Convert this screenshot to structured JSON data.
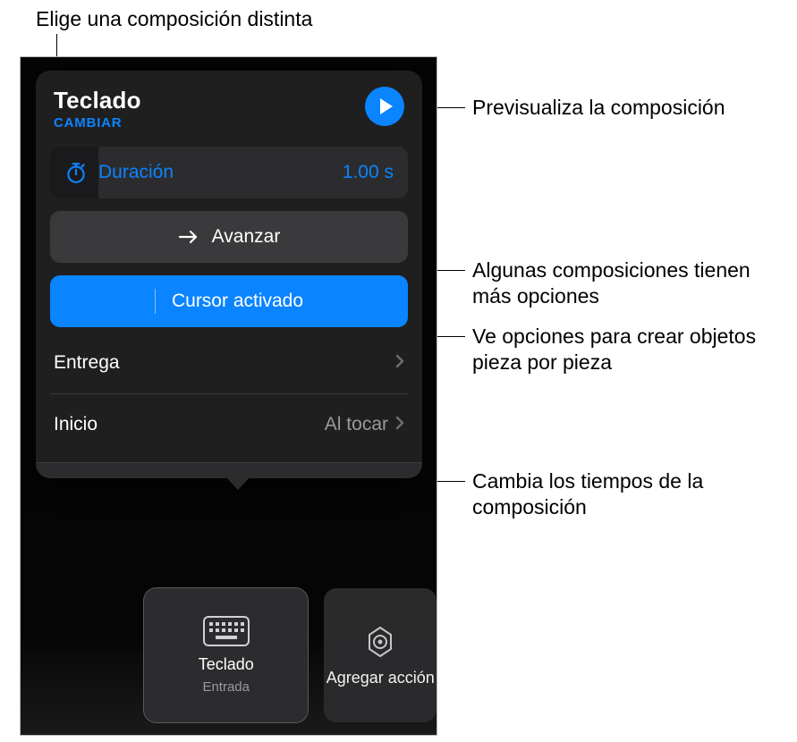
{
  "callouts": {
    "top": "Elige una composición distinta",
    "right1": "Previsualiza la composición",
    "right2": "Algunas composiciones tienen más opciones",
    "right3": "Ve opciones para crear objetos pieza por pieza",
    "right4": "Cambia los tiempos de la composición"
  },
  "popover": {
    "title": "Teclado",
    "change": "CAMBIAR",
    "duration_label": "Duración",
    "duration_value": "1.00 s",
    "advance_label": "Avanzar",
    "cursor_label": "Cursor activado",
    "delivery_label": "Entrega",
    "start_label": "Inicio",
    "start_value": "Al tocar"
  },
  "bottom": {
    "card1_title": "Teclado",
    "card1_sub": "Entrada",
    "card2_title": "Agregar acción"
  },
  "colors": {
    "accent": "#0a84ff",
    "panel": "#1f1f1f",
    "row_dark": "#2c2c2e",
    "row_mid": "#3a3a3c",
    "text_secondary": "#9a9a9f"
  }
}
